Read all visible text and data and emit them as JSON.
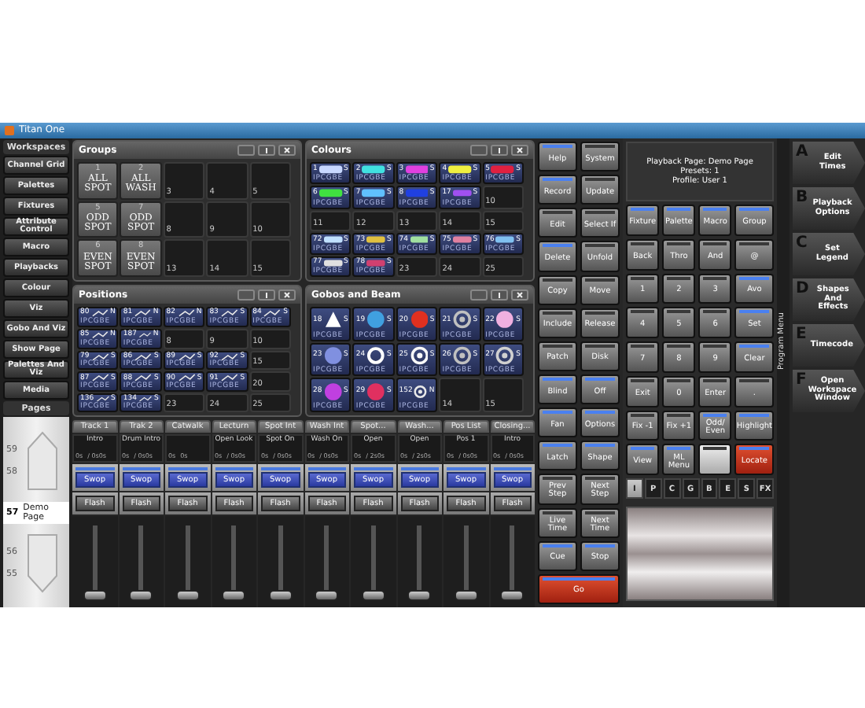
{
  "window": {
    "title": "Titan One"
  },
  "workspaces": {
    "title": "Workspaces",
    "items": [
      {
        "label": "Channel Grid"
      },
      {
        "label": "Palettes"
      },
      {
        "label": "Fixtures"
      },
      {
        "label": "Attribute Control"
      },
      {
        "label": "Macro"
      },
      {
        "label": "Playbacks"
      },
      {
        "label": "Colour"
      },
      {
        "label": "Viz"
      },
      {
        "label": "Gobo And Viz"
      },
      {
        "label": "Show Page"
      },
      {
        "label": "Palettes And Viz"
      },
      {
        "label": "Media"
      }
    ]
  },
  "pages": {
    "title": "Pages",
    "items": [
      {
        "number": "59",
        "selected": false
      },
      {
        "number": "58",
        "selected": false
      },
      {
        "number": "57",
        "name": "Demo Page",
        "selected": true
      },
      {
        "number": "56",
        "selected": false
      },
      {
        "number": "55",
        "selected": false
      }
    ]
  },
  "groups": {
    "title": "Groups",
    "tiles": [
      {
        "number": "1",
        "legend": "ALL SPOT",
        "kind": "group"
      },
      {
        "number": "2",
        "legend": "ALL WASH",
        "kind": "group"
      },
      {
        "number": "3",
        "kind": "empty"
      },
      {
        "number": "4",
        "kind": "empty"
      },
      {
        "number": "5",
        "kind": "empty"
      },
      {
        "number": "5",
        "legend": "ODD SPOT",
        "kind": "group"
      },
      {
        "number": "7",
        "legend": "ODD SPOT",
        "kind": "group"
      },
      {
        "number": "8",
        "kind": "empty"
      },
      {
        "number": "9",
        "kind": "empty"
      },
      {
        "number": "10",
        "kind": "empty"
      },
      {
        "number": "6",
        "legend": "EVEN SPOT",
        "kind": "group"
      },
      {
        "number": "8",
        "legend": "EVEN SPOT",
        "kind": "group"
      },
      {
        "number": "13",
        "kind": "empty"
      },
      {
        "number": "14",
        "kind": "empty"
      },
      {
        "number": "15",
        "kind": "empty"
      }
    ]
  },
  "colours": {
    "title": "Colours",
    "tiles": [
      {
        "number": "1",
        "type": "S",
        "letters": "IPCGBE",
        "kind": "colour",
        "color": "#c8d8ff"
      },
      {
        "number": "2",
        "type": "S",
        "letters": "IPCGBE",
        "kind": "colour",
        "color": "#40e0e0"
      },
      {
        "number": "3",
        "type": "S",
        "letters": "IPCGBE",
        "kind": "colour",
        "color": "#e040e0"
      },
      {
        "number": "4",
        "type": "S",
        "letters": "IPCGBE",
        "kind": "colour",
        "color": "#f0f040"
      },
      {
        "number": "5",
        "type": "S",
        "letters": "IPCGBE",
        "kind": "colour",
        "color": "#e02040"
      },
      {
        "number": "6",
        "type": "S",
        "letters": "IPCGBE",
        "kind": "colour",
        "color": "#40e040"
      },
      {
        "number": "7",
        "type": "S",
        "letters": "IPCGBE",
        "kind": "colour",
        "color": "#60c0ff"
      },
      {
        "number": "8",
        "type": "S",
        "letters": "IPCGBE",
        "kind": "colour",
        "color": "#2040e0"
      },
      {
        "number": "17",
        "type": "S",
        "letters": "IPCGBE",
        "kind": "colour",
        "color": "#a050f0"
      },
      {
        "number": "10",
        "kind": "empty"
      },
      {
        "number": "11",
        "kind": "empty"
      },
      {
        "number": "12",
        "kind": "empty"
      },
      {
        "number": "13",
        "kind": "empty"
      },
      {
        "number": "14",
        "kind": "empty"
      },
      {
        "number": "15",
        "kind": "empty"
      },
      {
        "number": "72",
        "type": "S",
        "letters": "IPCGBE",
        "kind": "colour",
        "color": "#c0e0ff"
      },
      {
        "number": "73",
        "type": "S",
        "letters": "IPCGBE",
        "kind": "colour",
        "color": "#e0c040"
      },
      {
        "number": "74",
        "type": "S",
        "letters": "IPCGBE",
        "kind": "colour",
        "color": "#a0e0a0"
      },
      {
        "number": "75",
        "type": "S",
        "letters": "IPCGBE",
        "kind": "colour",
        "color": "#e080a0"
      },
      {
        "number": "76",
        "type": "S",
        "letters": "IPCGBE",
        "kind": "colour",
        "color": "#80c0f0"
      },
      {
        "number": "77",
        "type": "S",
        "letters": "IPCGBE",
        "kind": "colour",
        "color": "#e0e0e0"
      },
      {
        "number": "78",
        "type": "S",
        "letters": "IPCGBE",
        "kind": "colour",
        "color": "#d04070"
      },
      {
        "number": "23",
        "kind": "empty"
      },
      {
        "number": "24",
        "kind": "empty"
      },
      {
        "number": "25",
        "kind": "empty"
      }
    ]
  },
  "positions": {
    "title": "Positions",
    "tiles": [
      {
        "number": "80",
        "type": "N",
        "letters": "IPCGBE",
        "kind": "position"
      },
      {
        "number": "81",
        "type": "N",
        "letters": "IPCGBE",
        "kind": "position"
      },
      {
        "number": "82",
        "type": "N",
        "letters": "IPCGBE",
        "kind": "position"
      },
      {
        "number": "83",
        "type": "S",
        "letters": "IPCGBE",
        "kind": "position"
      },
      {
        "number": "84",
        "type": "S",
        "letters": "IPCGBE",
        "kind": "position"
      },
      {
        "number": "85",
        "type": "N",
        "letters": "IPCGBE",
        "kind": "position"
      },
      {
        "number": "187",
        "type": "N",
        "letters": "IPCGBE",
        "kind": "position"
      },
      {
        "number": "8",
        "kind": "empty"
      },
      {
        "number": "9",
        "kind": "empty"
      },
      {
        "number": "10",
        "kind": "empty"
      },
      {
        "number": "79",
        "type": "S",
        "letters": "IPCGBE",
        "kind": "position"
      },
      {
        "number": "86",
        "type": "S",
        "letters": "IPCGBE",
        "kind": "position"
      },
      {
        "number": "89",
        "type": "S",
        "letters": "IPCGBE",
        "kind": "position"
      },
      {
        "number": "92",
        "type": "S",
        "letters": "IPCGBE",
        "kind": "position"
      },
      {
        "number": "15",
        "kind": "empty"
      },
      {
        "number": "87",
        "type": "S",
        "letters": "IPCGBE",
        "kind": "position"
      },
      {
        "number": "88",
        "type": "S",
        "letters": "IPCGBE",
        "kind": "position"
      },
      {
        "number": "90",
        "type": "S",
        "letters": "IPCGBE",
        "kind": "position"
      },
      {
        "number": "91",
        "type": "S",
        "letters": "IPCGBE",
        "kind": "position"
      },
      {
        "number": "20",
        "kind": "empty"
      },
      {
        "number": "136",
        "type": "S",
        "letters": "IPCGBE",
        "kind": "position"
      },
      {
        "number": "134",
        "type": "S",
        "letters": "IPCGBE",
        "kind": "position"
      },
      {
        "number": "23",
        "kind": "empty"
      },
      {
        "number": "24",
        "kind": "empty"
      },
      {
        "number": "25",
        "kind": "empty"
      }
    ]
  },
  "gobos": {
    "title": "Gobos and Beam",
    "tiles": [
      {
        "number": "18",
        "type": "S",
        "letters": "IPCGBE",
        "kind": "triangle",
        "color": "#ffffff"
      },
      {
        "number": "19",
        "type": "S",
        "letters": "IPCGBE",
        "kind": "disc",
        "color": "#40a0e0"
      },
      {
        "number": "20",
        "type": "S",
        "letters": "IPCGBE",
        "kind": "disc",
        "color": "#e03020"
      },
      {
        "number": "21",
        "type": "S",
        "letters": "IPCGBE",
        "kind": "rings",
        "color": "#c0c0c0"
      },
      {
        "number": "22",
        "type": "S",
        "letters": "IPCGBE",
        "kind": "disc",
        "color": "#f0b0e0"
      },
      {
        "number": "23",
        "type": "S",
        "letters": "IPCGBE",
        "kind": "disc",
        "color": "#8090e0"
      },
      {
        "number": "24",
        "type": "S",
        "letters": "IPCGBE",
        "kind": "ring",
        "color": "#ffffff"
      },
      {
        "number": "25",
        "type": "S",
        "letters": "IPCGBE",
        "kind": "rings",
        "color": "#f8f8f8"
      },
      {
        "number": "26",
        "type": "S",
        "letters": "IPCGBE",
        "kind": "rings",
        "color": "#c0c0c0"
      },
      {
        "number": "27",
        "type": "S",
        "letters": "IPCGBE",
        "kind": "rings",
        "color": "#d0d0d0"
      },
      {
        "number": "28",
        "type": "S",
        "letters": "IPCGBE",
        "kind": "disc",
        "color": "#c040e0"
      },
      {
        "number": "29",
        "type": "S",
        "letters": "IPCGBE",
        "kind": "disc",
        "color": "#e03060"
      },
      {
        "number": "152",
        "type": "N",
        "letters": "IPCGBE",
        "kind": "rings",
        "color": "#e8e8e8"
      },
      {
        "number": "14",
        "kind": "empty"
      },
      {
        "number": "15",
        "kind": "empty"
      }
    ]
  },
  "faders": [
    {
      "name": "Track 1",
      "cue": "Intro",
      "time_in": "0s",
      "time_out": "/ 0s0s",
      "swop": "Swop",
      "flash": "Flash",
      "level": 0
    },
    {
      "name": "Trak 2",
      "cue": "Drum Intro",
      "time_in": "0s",
      "time_out": "/ 0s0s",
      "swop": "Swop",
      "flash": "Flash",
      "level": 0
    },
    {
      "name": "Catwalk",
      "time_in": "0s",
      "time_out": "0s",
      "swop": "Swop",
      "flash": "Flash",
      "level": 0
    },
    {
      "name": "Lecturn",
      "cue": "Open Look",
      "time_in": "0s",
      "time_out": "/ 0s0s",
      "swop": "Swop",
      "flash": "Flash",
      "level": 0
    },
    {
      "name": "Spot Int",
      "cue": "Spot On",
      "time_in": "0s",
      "time_out": "/ 0s0s",
      "swop": "Swop",
      "flash": "Flash",
      "level": 0
    },
    {
      "name": "Wash Int",
      "cue": "Wash On",
      "time_in": "0s",
      "time_out": "/ 0s0s",
      "swop": "Swop",
      "flash": "Flash",
      "level": 0
    },
    {
      "name": "Spot...",
      "cue": "Open",
      "time_in": "0s",
      "time_out": "/ 2s0s",
      "swop": "Swop",
      "flash": "Flash",
      "level": 0
    },
    {
      "name": "Wash...",
      "cue": "Open",
      "time_in": "0s",
      "time_out": "/ 2s0s",
      "swop": "Swop",
      "flash": "Flash",
      "level": 0
    },
    {
      "name": "Pos List",
      "cue": "Pos 1",
      "time_in": "0s",
      "time_out": "/ 0s0s",
      "swop": "Swop",
      "flash": "Flash",
      "level": 0
    },
    {
      "name": "Closing...",
      "cue": "Intro",
      "time_in": "0s",
      "time_out": "/ 0s0s",
      "swop": "Swop",
      "flash": "Flash",
      "level": 0
    }
  ],
  "command_keys": [
    {
      "label": "Help",
      "indicator": true,
      "kind": "key"
    },
    {
      "label": "System",
      "indicator": false,
      "kind": "key"
    },
    {
      "label": "Record",
      "indicator": true,
      "kind": "key"
    },
    {
      "label": "Update",
      "indicator": false,
      "kind": "key"
    },
    {
      "label": "Edit",
      "indicator": false,
      "kind": "key"
    },
    {
      "label": "Select If",
      "indicator": false,
      "kind": "key"
    },
    {
      "label": "Delete",
      "indicator": true,
      "kind": "key"
    },
    {
      "label": "Unfold",
      "indicator": false,
      "kind": "key"
    },
    {
      "label": "Copy",
      "indicator": false,
      "kind": "key"
    },
    {
      "label": "Move",
      "indicator": false,
      "kind": "key"
    },
    {
      "label": "Include",
      "indicator": false,
      "kind": "key"
    },
    {
      "label": "Release",
      "indicator": false,
      "kind": "key"
    },
    {
      "label": "Patch",
      "indicator": false,
      "kind": "key"
    },
    {
      "label": "Disk",
      "indicator": false,
      "kind": "key"
    },
    {
      "label": "Blind",
      "indicator": true,
      "kind": "key"
    },
    {
      "label": "Off",
      "indicator": true,
      "kind": "key"
    },
    {
      "label": "Fan",
      "indicator": true,
      "kind": "key"
    },
    {
      "label": "Options",
      "indicator": true,
      "kind": "key"
    },
    {
      "label": "Latch",
      "indicator": true,
      "kind": "key"
    },
    {
      "label": "Shape",
      "indicator": true,
      "kind": "key"
    },
    {
      "label": "Prev Step",
      "indicator": false,
      "kind": "key"
    },
    {
      "label": "Next Step",
      "indicator": false,
      "kind": "key"
    },
    {
      "label": "Live Time",
      "indicator": false,
      "kind": "key"
    },
    {
      "label": "Next Time",
      "indicator": false,
      "kind": "key"
    },
    {
      "label": "Cue",
      "indicator": true,
      "kind": "key"
    },
    {
      "label": "Stop",
      "indicator": true,
      "kind": "key"
    },
    {
      "label": "Go",
      "indicator": true,
      "kind": "go"
    }
  ],
  "program": {
    "info": [
      "Playback Page: Demo Page",
      "Presets: 1",
      "Profile: User 1"
    ],
    "menu_label": "Program Menu",
    "keys": [
      {
        "label": "Fixture",
        "indicator": true,
        "kind": "key"
      },
      {
        "label": "Palette",
        "indicator": true,
        "kind": "key"
      },
      {
        "label": "Macro",
        "indicator": true,
        "kind": "key"
      },
      {
        "label": "Group",
        "indicator": true,
        "kind": "key"
      },
      {
        "label": "Back",
        "indicator": false,
        "kind": "key"
      },
      {
        "label": "Thro",
        "indicator": false,
        "kind": "key"
      },
      {
        "label": "And",
        "indicator": false,
        "kind": "key"
      },
      {
        "label": "@",
        "indicator": false,
        "kind": "key"
      },
      {
        "label": "1",
        "indicator": false,
        "kind": "key"
      },
      {
        "label": "2",
        "indicator": false,
        "kind": "key"
      },
      {
        "label": "3",
        "indicator": false,
        "kind": "key"
      },
      {
        "label": "Avo",
        "indicator": true,
        "kind": "key"
      },
      {
        "label": "4",
        "indicator": false,
        "kind": "key"
      },
      {
        "label": "5",
        "indicator": false,
        "kind": "key"
      },
      {
        "label": "6",
        "indicator": false,
        "kind": "key"
      },
      {
        "label": "Set",
        "indicator": true,
        "kind": "key"
      },
      {
        "label": "7",
        "indicator": false,
        "kind": "key"
      },
      {
        "label": "8",
        "indicator": false,
        "kind": "key"
      },
      {
        "label": "9",
        "indicator": false,
        "kind": "key"
      },
      {
        "label": "Clear",
        "indicator": true,
        "kind": "key"
      },
      {
        "label": "Exit",
        "indicator": false,
        "kind": "key"
      },
      {
        "label": "0",
        "indicator": false,
        "kind": "key"
      },
      {
        "label": "Enter",
        "indicator": false,
        "kind": "key"
      },
      {
        "label": ".",
        "indicator": false,
        "kind": "key"
      },
      {
        "label": "Fix -1",
        "indicator": false,
        "kind": "key"
      },
      {
        "label": "Fix +1",
        "indicator": false,
        "kind": "key"
      },
      {
        "label": "Odd/ Even",
        "indicator": true,
        "kind": "key"
      },
      {
        "label": "Highlight",
        "indicator": true,
        "kind": "key"
      },
      {
        "label": "View",
        "indicator": true,
        "kind": "key"
      },
      {
        "label": "ML Menu",
        "indicator": true,
        "kind": "key"
      },
      {
        "indicator": false,
        "kind": "blank"
      },
      {
        "label": "Locate",
        "indicator": true,
        "kind": "locate"
      }
    ]
  },
  "attribute_tabs": [
    {
      "label": "I",
      "selected": true
    },
    {
      "label": "P",
      "selected": false
    },
    {
      "label": "C",
      "selected": false
    },
    {
      "label": "G",
      "selected": false
    },
    {
      "label": "B",
      "selected": false
    },
    {
      "label": "E",
      "selected": false
    },
    {
      "label": "S",
      "selected": false
    },
    {
      "label": "FX",
      "selected": false
    }
  ],
  "softkeys": [
    {
      "letter": "A",
      "label": "Edit Times"
    },
    {
      "letter": "B",
      "label": "Playback Options"
    },
    {
      "letter": "C",
      "label": "Set Legend"
    },
    {
      "letter": "D",
      "label": "Shapes And Effects"
    },
    {
      "letter": "E",
      "label": "Timecode"
    },
    {
      "letter": "F",
      "label": "Open Workspace Window"
    }
  ]
}
